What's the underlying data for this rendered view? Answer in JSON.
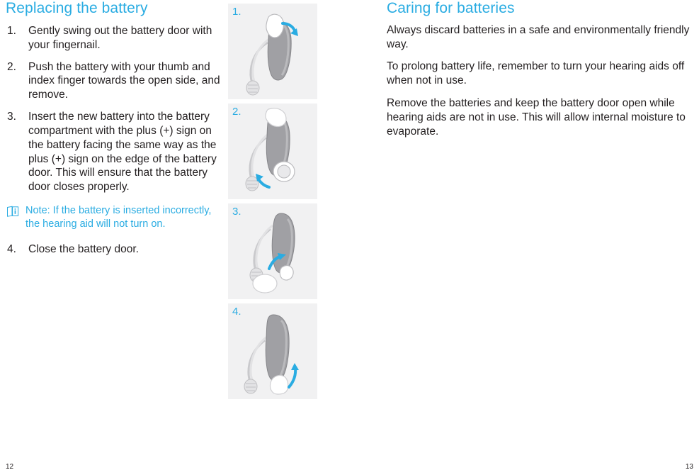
{
  "left_page": {
    "title": "Replacing the battery",
    "steps": [
      {
        "num": "1.",
        "text": "Gently swing out the battery door with your fingernail."
      },
      {
        "num": "2.",
        "text": "Push the battery with your thumb and index finger towards the open side, and remove."
      },
      {
        "num": "3.",
        "text": "Insert the new battery into the battery compartment with the plus (+) sign on the battery facing the same way as the plus (+) sign on the edge of the battery door. This will ensure that the battery door closes properly."
      }
    ],
    "note": {
      "icon": "note-info-icon",
      "text": "Note: If the battery is inserted incorrectly, the hearing aid will not turn on."
    },
    "final_step": {
      "num": "4.",
      "text": "Close the battery door."
    },
    "page_number": "12"
  },
  "figures": [
    {
      "num": "1.",
      "name": "figure-swing-out-battery-door"
    },
    {
      "num": "2.",
      "name": "figure-push-battery-out"
    },
    {
      "num": "3.",
      "name": "figure-insert-new-battery"
    },
    {
      "num": "4.",
      "name": "figure-close-battery-door"
    }
  ],
  "right_page": {
    "title": "Caring for batteries",
    "paragraphs": [
      "Always discard batteries in a safe and environmentally friendly way.",
      "To prolong battery life, remember to turn your hearing aids off when not in use.",
      "Remove the batteries and keep the battery door open while hearing aids are not in use. This will allow internal moisture to evaporate."
    ],
    "page_number": "13"
  },
  "colors": {
    "accent": "#2aace2",
    "text": "#231f20",
    "figure_bg": "#f1f1f2",
    "device_gray": "#9b9b9f"
  }
}
